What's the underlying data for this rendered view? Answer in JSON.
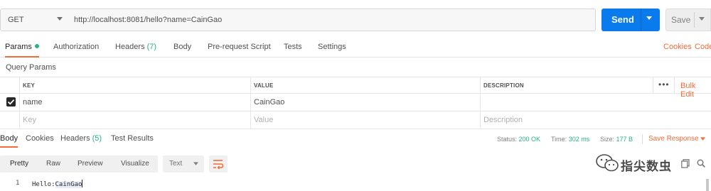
{
  "request": {
    "method": "GET",
    "url": "http://localhost:8081/hello?name=CainGao",
    "send_label": "Send",
    "save_label": "Save"
  },
  "request_tabs": {
    "params": "Params",
    "authorization": "Authorization",
    "headers": "Headers",
    "headers_count": "(7)",
    "body": "Body",
    "prerequest": "Pre-request Script",
    "tests": "Tests",
    "settings": "Settings",
    "cookies": "Cookies",
    "code": "Code"
  },
  "query_params": {
    "title": "Query Params",
    "columns": {
      "key": "KEY",
      "value": "VALUE",
      "description": "DESCRIPTION"
    },
    "bulk_edit": "Bulk Edit",
    "more": "•••",
    "rows": [
      {
        "checked": true,
        "key": "name",
        "value": "CainGao",
        "description": ""
      }
    ],
    "placeholder": {
      "key": "Key",
      "value": "Value",
      "description": "Description"
    }
  },
  "response_tabs": {
    "body": "Body",
    "cookies": "Cookies",
    "headers": "Headers",
    "headers_count": "(5)",
    "test_results": "Test Results",
    "status_label": "Status:",
    "status_value": "200 OK",
    "time_label": "Time:",
    "time_value": "302 ms",
    "size_label": "Size:",
    "size_value": "177 B",
    "save_response": "Save Response"
  },
  "response_toolbar": {
    "views": [
      "Pretty",
      "Raw",
      "Preview",
      "Visualize"
    ],
    "active_view": "Pretty",
    "format": "Text"
  },
  "response_body": {
    "lines": [
      {
        "number": "1",
        "prefix": "Hello:",
        "highlight": "CainGao"
      }
    ]
  },
  "watermark": {
    "text": "指尖数虫"
  },
  "colors": {
    "accent": "#f26b3a",
    "send": "#097bed",
    "success": "#26b47f"
  },
  "icons": [
    "chevron-down-icon",
    "check-icon",
    "wrap-lines-icon",
    "copy-icon",
    "search-icon",
    "wechat-logo-icon"
  ]
}
